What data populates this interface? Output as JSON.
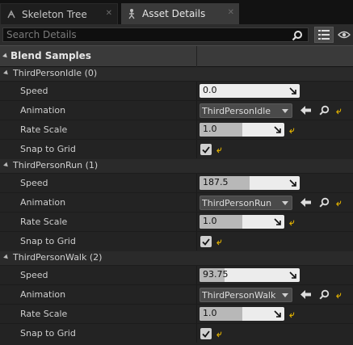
{
  "tabs": [
    {
      "label": "Skeleton Tree",
      "icon": "skeleton-icon",
      "active": false
    },
    {
      "label": "Asset Details",
      "icon": "asset-details-icon",
      "active": true
    }
  ],
  "search": {
    "placeholder": "Search Details",
    "value": ""
  },
  "category": {
    "label": "Blend Samples"
  },
  "samples": [
    {
      "group": "ThirdPersonIdle (0)",
      "speed": {
        "label": "Speed",
        "value": "0.0",
        "fill": 0.0
      },
      "animation": {
        "label": "Animation",
        "value": "ThirdPersonIdle"
      },
      "rate_scale": {
        "label": "Rate Scale",
        "value": "1.0",
        "fill": 0.5
      },
      "snap": {
        "label": "Snap to Grid",
        "checked": true
      }
    },
    {
      "group": "ThirdPersonRun (1)",
      "speed": {
        "label": "Speed",
        "value": "187.5",
        "fill": 0.5
      },
      "animation": {
        "label": "Animation",
        "value": "ThirdPersonRun"
      },
      "rate_scale": {
        "label": "Rate Scale",
        "value": "1.0",
        "fill": 0.5
      },
      "snap": {
        "label": "Snap to Grid",
        "checked": true
      }
    },
    {
      "group": "ThirdPersonWalk (2)",
      "speed": {
        "label": "Speed",
        "value": "93.75",
        "fill": 0.25
      },
      "animation": {
        "label": "Animation",
        "value": "ThirdPersonWalk"
      },
      "rate_scale": {
        "label": "Rate Scale",
        "value": "1.0",
        "fill": 0.5
      },
      "snap": {
        "label": "Snap to Grid",
        "checked": true
      }
    }
  ],
  "colors": {
    "reset_arrow": "#e0b000",
    "panel": "#232323",
    "header": "#3a3a3a"
  }
}
